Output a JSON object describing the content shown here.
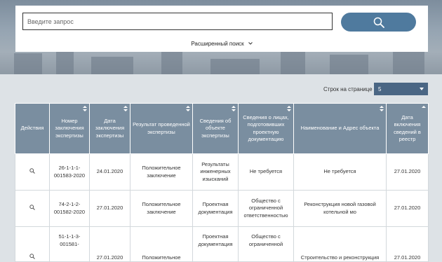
{
  "search": {
    "placeholder": "Введите запрос",
    "advanced_label": "Расширенный поиск"
  },
  "paging": {
    "rows_label": "Строк на странице",
    "rows_value": "5"
  },
  "table": {
    "columns": [
      "Действия",
      "Номер заключения экспертизы",
      "Дата заключения экспертизы",
      "Результат проведенной экспертизы",
      "Сведения об объекте экспертизы",
      "Сведения о лицах, подготовивших проектную документацию",
      "Наименование и Адрес объекта",
      "Дата включения сведений в реестр"
    ],
    "rows": [
      [
        "26-1-1-1-001583-2020",
        "24.01.2020",
        "Положительное заключение",
        "Результаты инженерных изысканий",
        "Не требуется",
        "Не требуется",
        "27.01.2020"
      ],
      [
        "74-2-1-2-001582-2020",
        "27.01.2020",
        "Положительное заключение",
        "Проектная документация",
        "Общество с ограниченной ответственностью",
        "Реконструкция новой газовой котельной мо",
        "27.01.2020"
      ],
      [
        "51-1-1-3-001581-",
        "27.01.2020",
        "Положительное",
        "Проектная документация",
        "Общество с ограниченной",
        "Строительство и реконструкция",
        "27.01.2020"
      ]
    ]
  },
  "colors": {
    "header_bg": "#7a8ea0",
    "search_button": "#4f7a9e",
    "select_bg": "#4a6684",
    "page_bg": "#dde2e6"
  }
}
